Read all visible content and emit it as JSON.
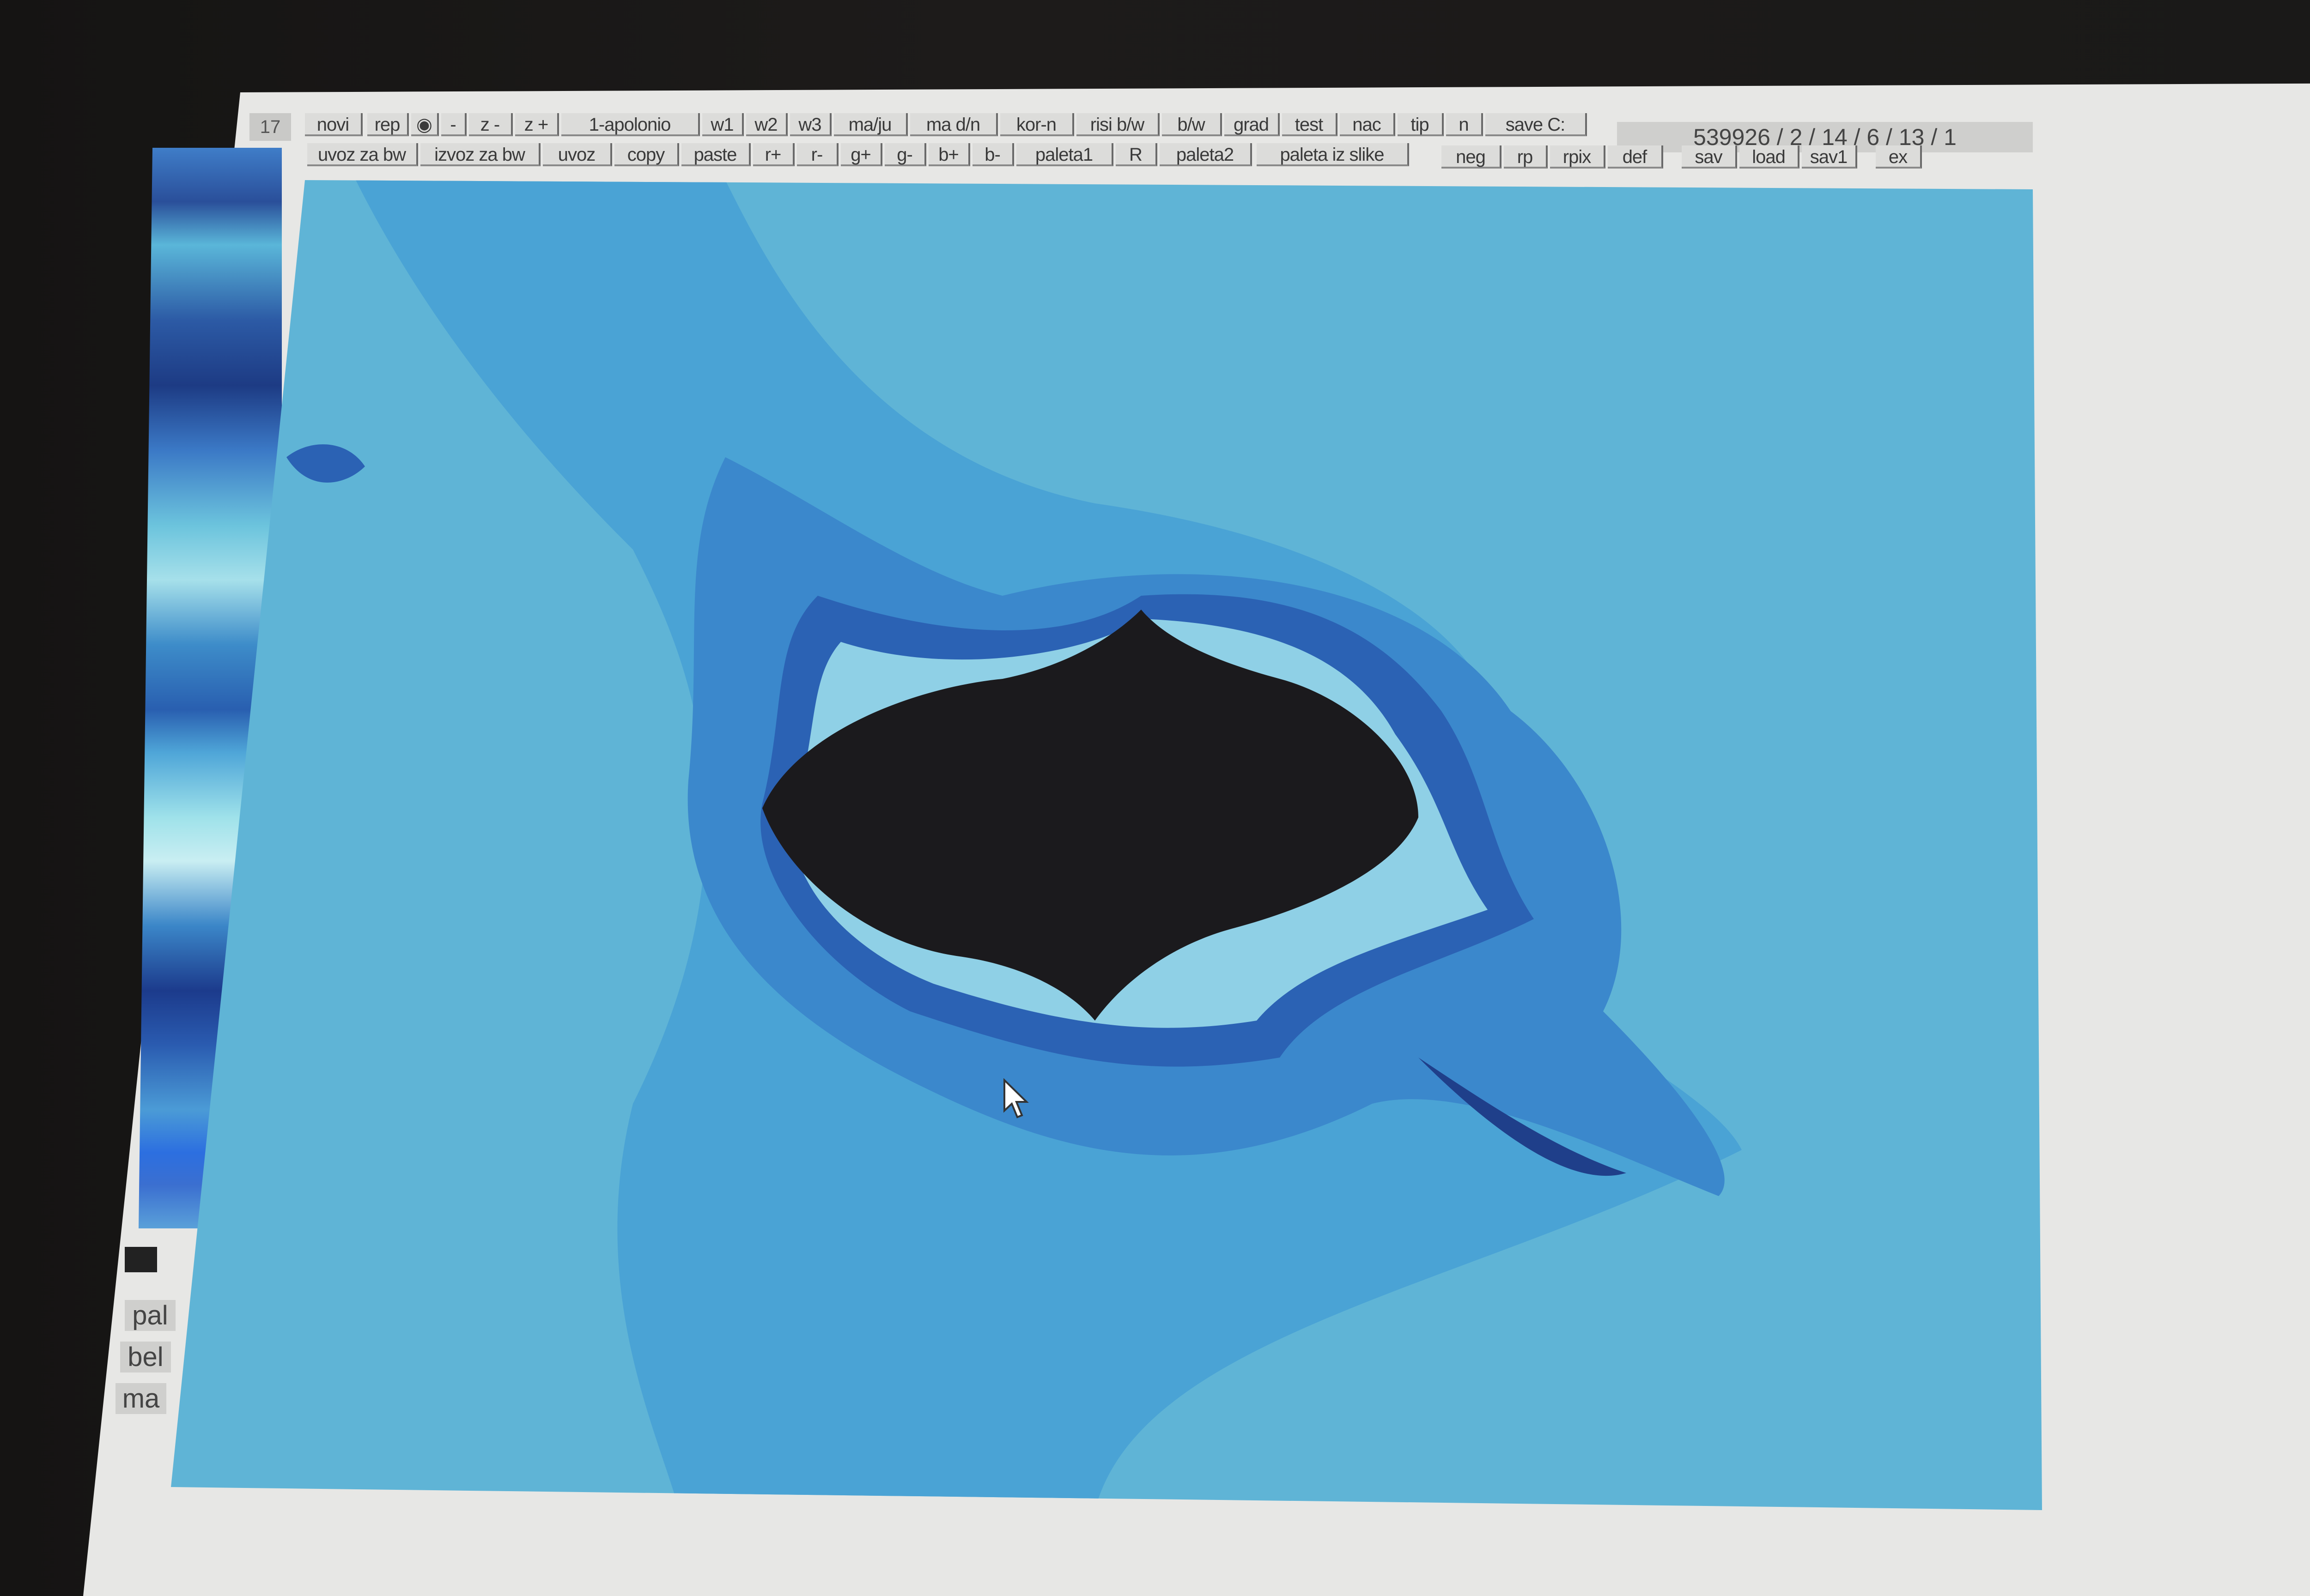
{
  "window": {
    "frame_counter": "17"
  },
  "toolbar": {
    "row1": [
      "novi",
      "rep",
      "-",
      "z -",
      "z +",
      "1-apolonio",
      "w1",
      "w2",
      "w3",
      "ma/ju",
      "ma d/n",
      "kor-n",
      "risi b/w",
      "b/w",
      "grad",
      "test",
      "nac",
      "tip",
      "n",
      "save C:"
    ],
    "row2": [
      "uvoz za bw",
      "izvoz za bw",
      "uvoz",
      "copy",
      "paste",
      "r+",
      "r-",
      "g+",
      "g-",
      "b+",
      "b-",
      "paleta1",
      "R",
      "paleta2",
      "paleta iz slike",
      "neg",
      "rp",
      "rpix",
      "def",
      "sav",
      "load",
      "sav1",
      "ex"
    ],
    "status": "539926 / 2 / 14 / 6 / 13 / 1"
  },
  "side": {
    "pal": "pal",
    "bel": "bel",
    "ma": "ma"
  },
  "colors": {
    "fractal_light": "#5fb4d6",
    "fractal_mid": "#3e8fcd",
    "fractal_deep": "#2b62b4",
    "fractal_core": "#1b1a1d",
    "screen_bg": "#e7e7e5"
  }
}
